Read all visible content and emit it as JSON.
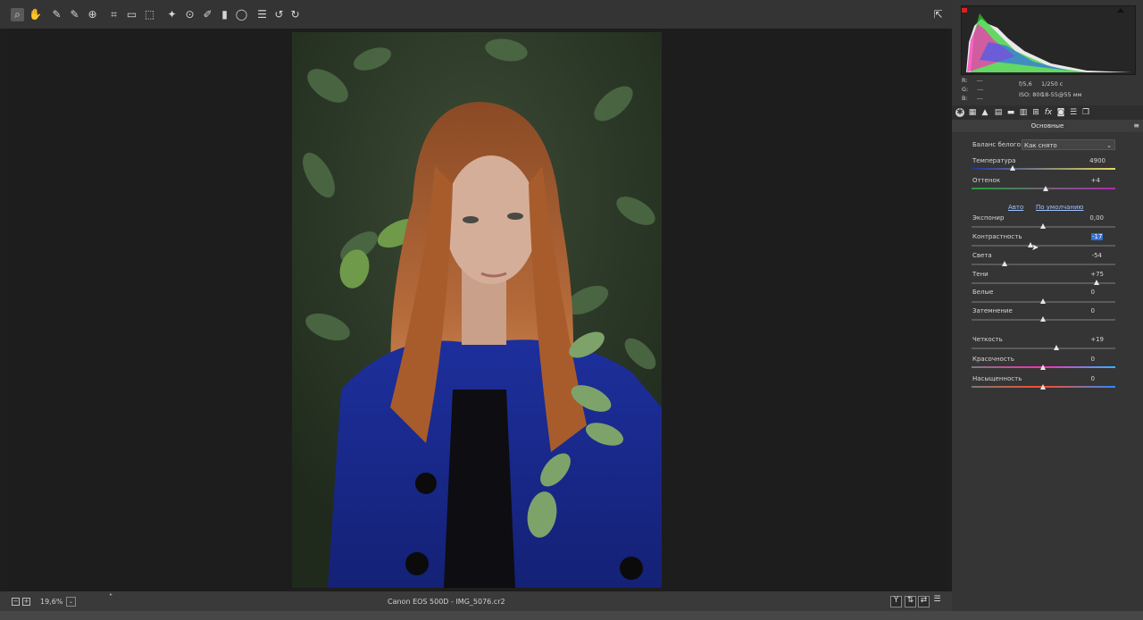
{
  "toolbar": {
    "tools": [
      "zoom-icon",
      "hand-icon",
      "white-balance-icon",
      "color-sampler-icon",
      "targeted-adjustment-icon",
      "crop-icon",
      "straighten-icon",
      "transform-icon",
      "spot-removal-icon",
      "red-eye-icon",
      "adjustment-brush-icon",
      "graduated-filter-icon",
      "radial-filter-icon",
      "preferences-icon",
      "rotate-left-icon",
      "rotate-right-icon"
    ],
    "glyphs": [
      "⌕",
      "✋",
      "✎",
      "✎",
      "⊕",
      "⌗",
      "▭",
      "⬚",
      "✦",
      "⊙",
      "✐",
      "▮",
      "◯",
      "☰",
      "↺",
      "↻"
    ],
    "fullscreen_glyph": "⇱"
  },
  "status": {
    "zoom": "19,6%",
    "filename": "Canon EOS 500D  -  IMG_5076.cr2",
    "compare_y": "Y"
  },
  "info": {
    "r_label": "R:",
    "r_value": "---",
    "g_label": "G:",
    "g_value": "---",
    "b_label": "B:",
    "b_value": "---",
    "aperture": "f/5,6",
    "shutter": "1/250 с",
    "iso": "ISO: 800",
    "lens": "18-55@55 мм"
  },
  "panel": {
    "section_title": "Основные",
    "white_balance_label": "Баланс белого:",
    "white_balance_value": "Как снято",
    "auto_link": "Авто",
    "default_link": "По умолчанию",
    "sliders": [
      {
        "label": "Температура",
        "value": "4900",
        "level": 0.29
      },
      {
        "label": "Оттенок",
        "value": "+4",
        "level": 0.52
      },
      {
        "label": "Экспонир",
        "value": "0,00",
        "level": 0.5
      },
      {
        "label": "Контрастность",
        "value": "-17",
        "level": 0.415
      },
      {
        "label": "Света",
        "value": "-54",
        "level": 0.23
      },
      {
        "label": "Тени",
        "value": "+75",
        "level": 0.875
      },
      {
        "label": "Белые",
        "value": "0",
        "level": 0.5
      },
      {
        "label": "Затемнение",
        "value": "0",
        "level": 0.5
      },
      {
        "label": "Четкость",
        "value": "+19",
        "level": 0.595
      },
      {
        "label": "Красочность",
        "value": "0",
        "level": 0.5
      },
      {
        "label": "Насыщенность",
        "value": "0",
        "level": 0.5
      }
    ]
  },
  "colors": {
    "accent_select": "#2f6fd1",
    "temperature_gradient": [
      "#2035a0",
      "#e6d95a"
    ],
    "tint_gradient": [
      "#22a03a",
      "#b02ab0"
    ],
    "vibrance_gradient": [
      "#7a7a7a",
      "#ff2ab8",
      "#2ab8ff"
    ]
  }
}
